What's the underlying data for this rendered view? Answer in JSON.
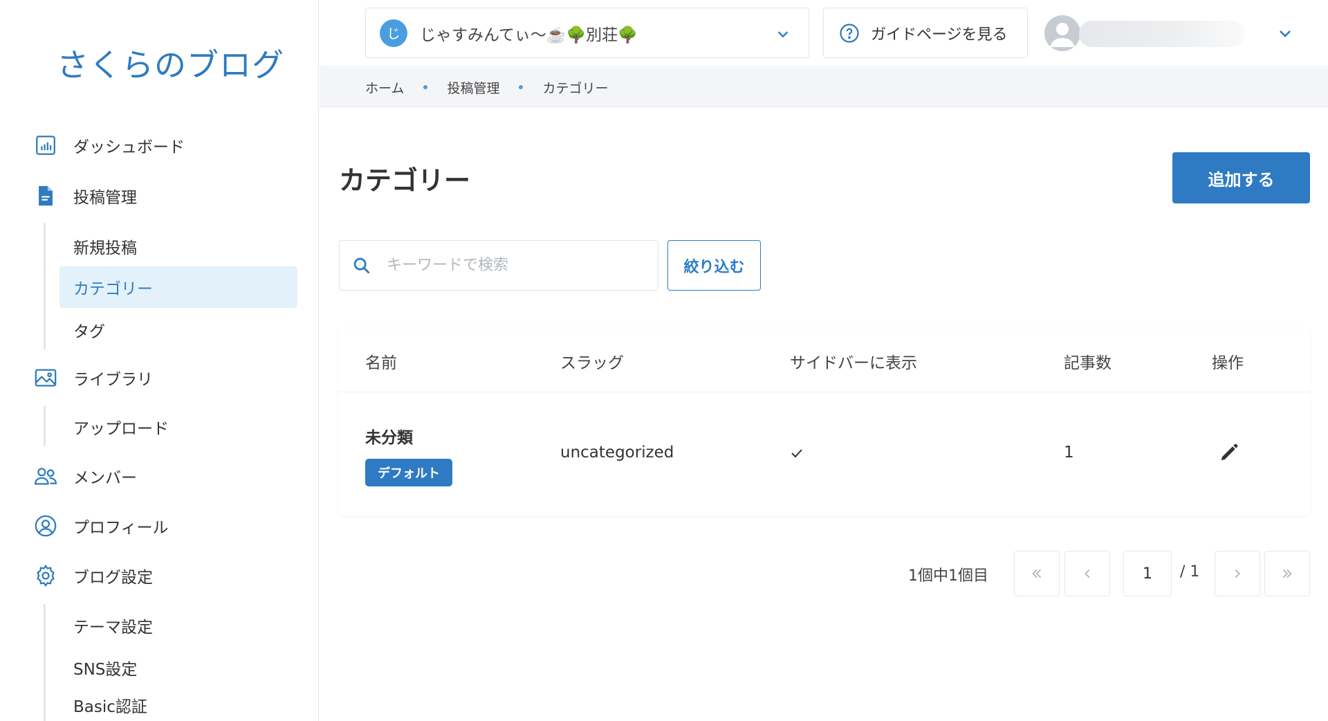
{
  "sidebar": {
    "logo": "さくらのブログ",
    "items": [
      {
        "label": "ダッシュボード",
        "icon": "bar-chart-icon"
      },
      {
        "label": "投稿管理",
        "icon": "document-icon"
      },
      {
        "label": "ライブラリ",
        "icon": "image-icon"
      },
      {
        "label": "メンバー",
        "icon": "users-icon"
      },
      {
        "label": "プロフィール",
        "icon": "user-circle-icon"
      },
      {
        "label": "ブログ設定",
        "icon": "gear-icon"
      }
    ],
    "post_sub": [
      "新規投稿",
      "カテゴリー",
      "タグ"
    ],
    "library_sub": [
      "アップロード"
    ],
    "settings_sub": [
      "テーマ設定",
      "SNS設定",
      "Basic認証"
    ]
  },
  "topbar": {
    "blog_initial": "じ",
    "blog_name": "じゃすみんてぃ〜☕️🌳別荘🌳",
    "guide_label": "ガイドページを見る"
  },
  "breadcrumb": [
    "ホーム",
    "投稿管理",
    "カテゴリー"
  ],
  "page": {
    "title": "カテゴリー",
    "add_label": "追加する",
    "search_placeholder": "キーワードで検索",
    "search_value": "",
    "filter_label": "絞り込む"
  },
  "table": {
    "headers": [
      "名前",
      "スラッグ",
      "サイドバーに表示",
      "記事数",
      "操作"
    ],
    "rows": [
      {
        "name": "未分類",
        "badge": "デフォルト",
        "slug": "uncategorized",
        "sidebar": "✓",
        "count": "1"
      }
    ]
  },
  "pagination": {
    "summary": "1個中1個目",
    "current": "1",
    "total": "/ 1"
  },
  "colors": {
    "accent": "#2e7bc4",
    "logo": "#2e7bbf",
    "active_bg": "#e3f1fb"
  }
}
